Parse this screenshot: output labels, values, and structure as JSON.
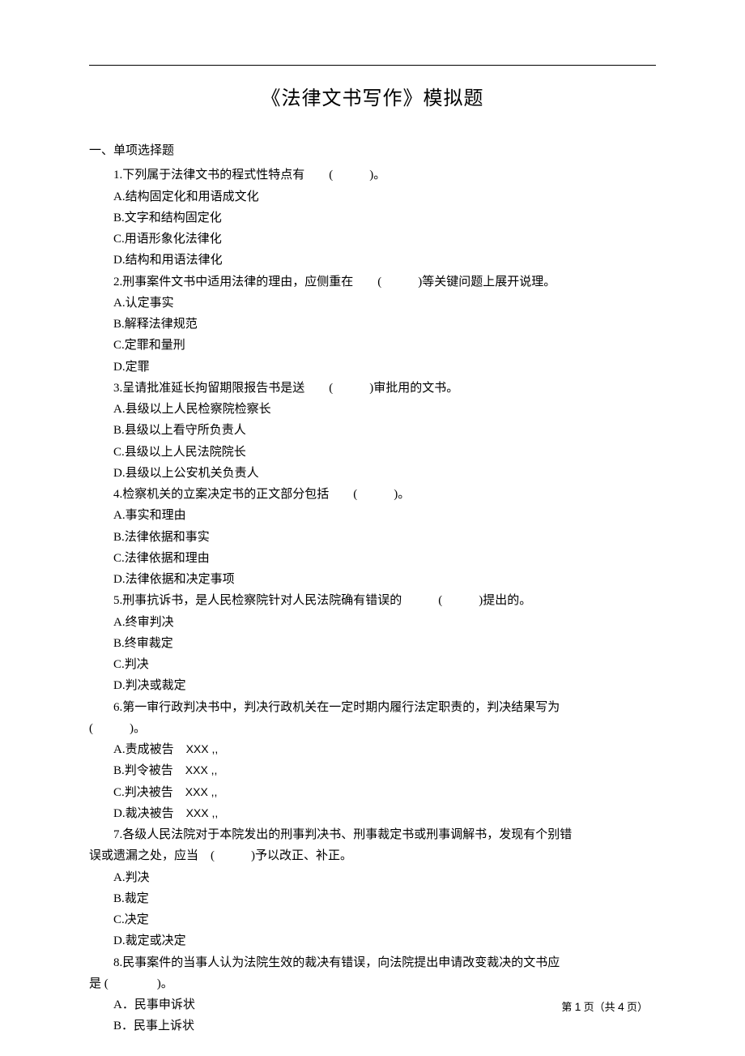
{
  "title": "《法律文书写作》模拟题",
  "section1": {
    "heading": "一、单项选择题",
    "q1": {
      "stem": "1.下列属于法律文书的程式性特点有　　(　　　)。",
      "a": "A.结构固定化和用语成文化",
      "b": "B.文字和结构固定化",
      "c": "C.用语形象化法律化",
      "d": "D.结构和用语法律化"
    },
    "q2": {
      "stem": "2.刑事案件文书中适用法律的理由，应侧重在　　(　　　)等关键问题上展开说理。",
      "a": "A.认定事实",
      "b": "B.解释法律规范",
      "c": "C.定罪和量刑",
      "d": "D.定罪"
    },
    "q3": {
      "stem": "3.呈请批准延长拘留期限报告书是送　　(　　　)审批用的文书。",
      "a": "A.县级以上人民检察院检察长",
      "b": "B.县级以上看守所负责人",
      "c": "C.县级以上人民法院院长",
      "d": "D.县级以上公安机关负责人"
    },
    "q4": {
      "stem": "4.检察机关的立案决定书的正文部分包括　　(　　　)。",
      "a": "A.事实和理由",
      "b": "B.法律依据和事实",
      "c": "C.法律依据和理由",
      "d": "D.法律依据和决定事项"
    },
    "q5": {
      "stem": "5.刑事抗诉书，是人民检察院针对人民法院确有错误的　　　(　　　)提出的。",
      "a": "A.终审判决",
      "b": "B.终审裁定",
      "c": "C.判决",
      "d": "D.判决或裁定"
    },
    "q6": {
      "stem1": "6.第一审行政判决书中，判决行政机关在一定时期内履行法定职责的，判决结果写为",
      "stem2": "(　　　)。",
      "a_pre": "A.责成被告　",
      "a_x": "XXX ,,",
      "b_pre": "B.判令被告　",
      "b_x": "XXX ,,",
      "c_pre": "C.判决被告　",
      "c_x": "XXX ,,",
      "d_pre": "D.裁决被告　",
      "d_x": "XXX ,,"
    },
    "q7": {
      "stem1": "7.各级人民法院对于本院发出的刑事判决书、刑事裁定书或刑事调解书，发现有个别错",
      "stem2": "误或遗漏之处，应当　(　　　)予以改正、补正。",
      "a": "A.判决",
      "b": "B.裁定",
      "c": "C.决定",
      "d": "D.裁定或决定"
    },
    "q8": {
      "stem1": "8.民事案件的当事人认为法院生效的裁决有错误，向法院提出申请改变裁决的文书应",
      "stem2": "是 (　　　　)。",
      "a": "A．民事申诉状",
      "b": "B．民事上诉状"
    }
  },
  "footer": {
    "pre": "第 ",
    "current": "1",
    "mid": " 页（共 ",
    "total": "4",
    "post": " 页）"
  }
}
